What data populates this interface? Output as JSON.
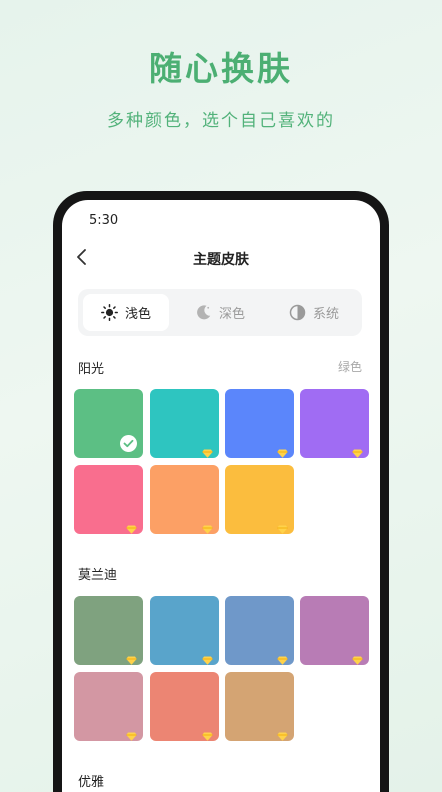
{
  "hero": {
    "title": "随心换肤",
    "subtitle": "多种颜色，选个自己喜欢的"
  },
  "status": {
    "time": "5:30"
  },
  "nav": {
    "title": "主题皮肤",
    "back_icon": "chevron-left-icon"
  },
  "mode_tabs": [
    {
      "label": "浅色",
      "icon": "sun-icon",
      "active": true
    },
    {
      "label": "深色",
      "icon": "moon-icon",
      "active": false
    },
    {
      "label": "系统",
      "icon": "half-circle-icon",
      "active": false
    }
  ],
  "sections": [
    {
      "title": "阳光",
      "right_label": "绿色",
      "swatches": [
        {
          "color": "#5cbf84",
          "selected": true
        },
        {
          "color": "#2ec5c0",
          "premium": true
        },
        {
          "color": "#5b86fb",
          "premium": true
        },
        {
          "color": "#a06cf3",
          "premium": true
        },
        {
          "color": "#f96e8e",
          "premium": true
        },
        {
          "color": "#fca065",
          "premium": true
        },
        {
          "color": "#fbbd3e",
          "premium": true
        }
      ]
    },
    {
      "title": "莫兰迪",
      "right_label": "",
      "swatches": [
        {
          "color": "#7fa27f",
          "premium": true
        },
        {
          "color": "#59a4cb",
          "premium": true
        },
        {
          "color": "#6f98c9",
          "premium": true
        },
        {
          "color": "#b87cb5",
          "premium": true
        },
        {
          "color": "#d397a3",
          "premium": true
        },
        {
          "color": "#ec8573",
          "premium": true
        },
        {
          "color": "#d4a473",
          "premium": true
        }
      ]
    },
    {
      "title": "优雅",
      "right_label": "",
      "swatches": []
    }
  ],
  "colors": {
    "brand_green": "#4caf73"
  }
}
